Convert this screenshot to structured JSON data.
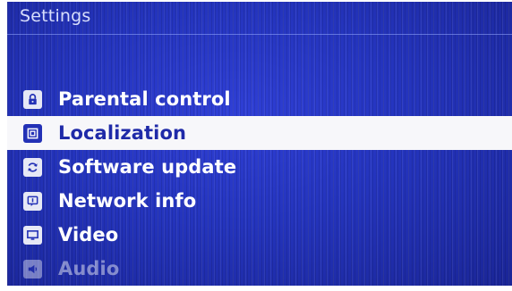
{
  "header": {
    "title": "Settings"
  },
  "menu": {
    "items": [
      {
        "label": "Parental control",
        "icon": "lock-icon",
        "selected": false
      },
      {
        "label": "Localization",
        "icon": "localization-icon",
        "selected": true
      },
      {
        "label": "Software update",
        "icon": "refresh-icon",
        "selected": false
      },
      {
        "label": "Network info",
        "icon": "network-info-icon",
        "selected": false
      },
      {
        "label": "Video",
        "icon": "monitor-icon",
        "selected": false
      },
      {
        "label": "Audio",
        "icon": "speaker-icon",
        "selected": false
      }
    ]
  },
  "colors": {
    "background": "#2434bd",
    "highlight": "#f7f7fa",
    "highlight_text": "#1f2aa8",
    "text": "#ffffff"
  }
}
